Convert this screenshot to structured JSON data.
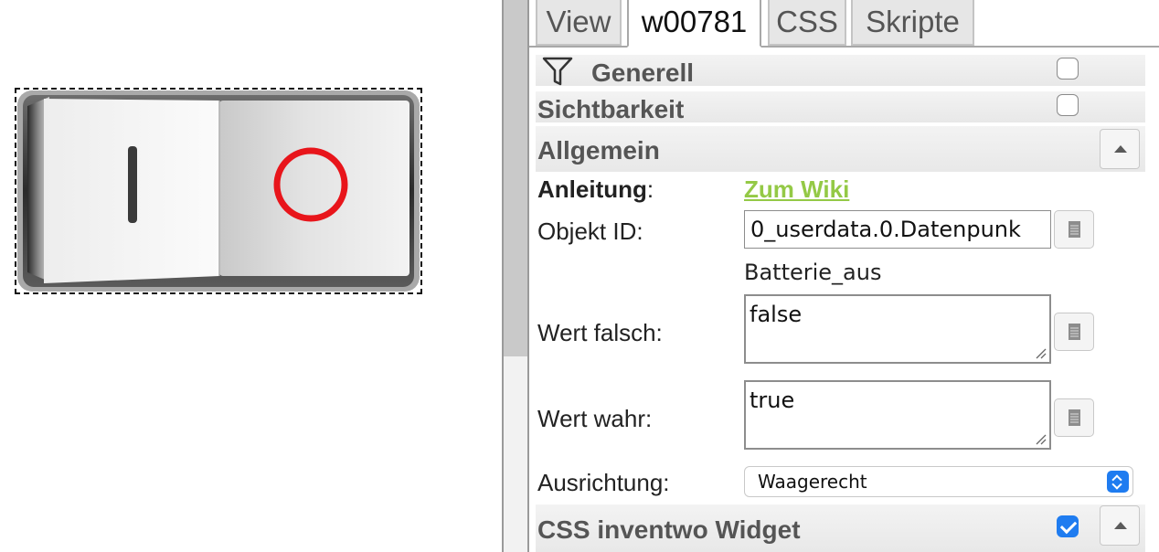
{
  "tabs": [
    {
      "label": "View",
      "active": false
    },
    {
      "label": "w00781",
      "active": true
    },
    {
      "label": "CSS",
      "active": false
    },
    {
      "label": "Skripte",
      "active": false
    }
  ],
  "widget": {
    "on_symbol": "I",
    "off_symbol": "O",
    "off_symbol_color": "#e8151b"
  },
  "groups": {
    "generell": {
      "label": "Generell",
      "icon": "filter-icon",
      "checked": false
    },
    "sichtbarkeit": {
      "label": "Sichtbarkeit",
      "checked": false
    },
    "allgemein": {
      "label": "Allgemein"
    },
    "css_widget": {
      "label": "CSS inventwo Widget",
      "checked": true
    }
  },
  "fields": {
    "anleitung": {
      "label": "Anleitung",
      "colon": ":",
      "link_text": "Zum Wiki",
      "link_color": "#94c946"
    },
    "objekt_id": {
      "label": "Objekt ID:",
      "value": "0_userdata.0.Datenpunk",
      "subtext": "Batterie_aus"
    },
    "wert_falsch": {
      "label": "Wert falsch:",
      "value": "false"
    },
    "wert_wahr": {
      "label": "Wert wahr:",
      "value": "true"
    },
    "ausrichtung": {
      "label": "Ausrichtung:",
      "value": "Waagerecht"
    }
  },
  "colors": {
    "accent": "#1f7cf0",
    "link": "#94c946"
  }
}
